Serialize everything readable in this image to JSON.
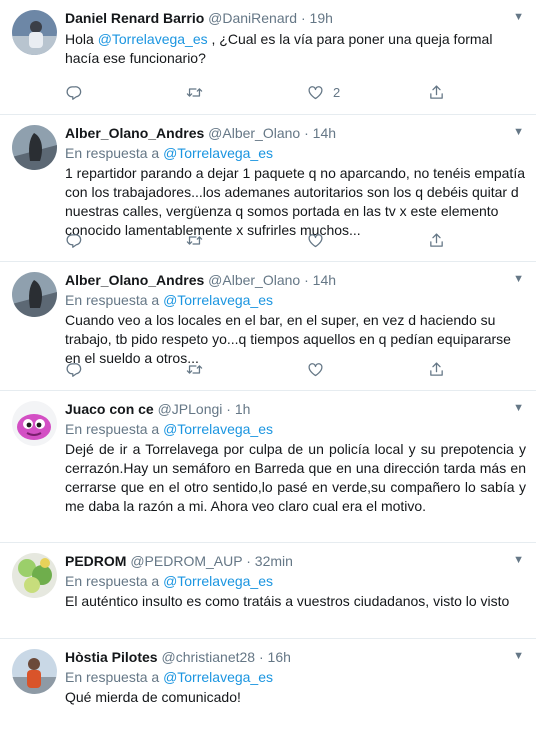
{
  "tweets": [
    {
      "name": "Daniel Renard Barrio",
      "handle": "@DaniRenard",
      "time": "19h",
      "text_before": "Hola ",
      "mention": "@Torrelavega_es",
      "text_after": " , ¿Cual es la vía para poner una queja formal hacía ese funcionario?",
      "likes": "2"
    },
    {
      "name": "Alber_Olano_Andres",
      "handle": "@Alber_Olano",
      "time": "14h",
      "reply_prefix": "En respuesta a",
      "reply_to": "@Torrelavega_es",
      "text": "1 repartidor parando a dejar 1 paquete q no aparcando, no tenéis empatía con los trabajadores...los ademanes autoritarios son los q debéis quitar d nuestras calles, vergüenza q somos portada en las tv x este elemento conocido lamentablemente x sufrirles muchos..."
    },
    {
      "name": "Alber_Olano_Andres",
      "handle": "@Alber_Olano",
      "time": "14h",
      "reply_prefix": "En respuesta a",
      "reply_to": "@Torrelavega_es",
      "text": "Cuando veo a los locales en el bar, en el super, en vez d haciendo su trabajo, tb pido respeto yo...q tiempos aquellos en q pedían equipararse en el sueldo a otros..."
    },
    {
      "name": "Juaco con ce",
      "handle": "@JPLongi",
      "time": "1h",
      "reply_prefix": "En respuesta a",
      "reply_to": "@Torrelavega_es",
      "text": "Dejé de ir a Torrelavega por culpa de un policía local y su prepotencia y cerrazón.Hay un semáforo en Barreda que en una dirección tarda más en cerrarse que en el otro sentido,lo pasé en verde,su compañero lo sabía y me daba la razón a mi. Ahora veo claro cual era el motivo."
    },
    {
      "name": "PEDROM",
      "handle": "@PEDROM_AUP",
      "time": "32min",
      "reply_prefix": "En respuesta a",
      "reply_to": "@Torrelavega_es",
      "text": "El auténtico insulto es como tratáis a vuestros ciudadanos, visto lo visto"
    },
    {
      "name": "Hòstia Pilotes",
      "handle": "@christianet28",
      "time": "16h",
      "reply_prefix": "En respuesta a",
      "reply_to": "@Torrelavega_es",
      "text": "Qué mierda de comunicado!"
    }
  ],
  "separator": "·",
  "icons": [
    "reply-icon",
    "retweet-icon",
    "like-icon",
    "share-icon",
    "caret-down-icon"
  ],
  "colors": {
    "link": "#1b95e0",
    "secondary": "#657786",
    "border": "#e6ecf0"
  }
}
